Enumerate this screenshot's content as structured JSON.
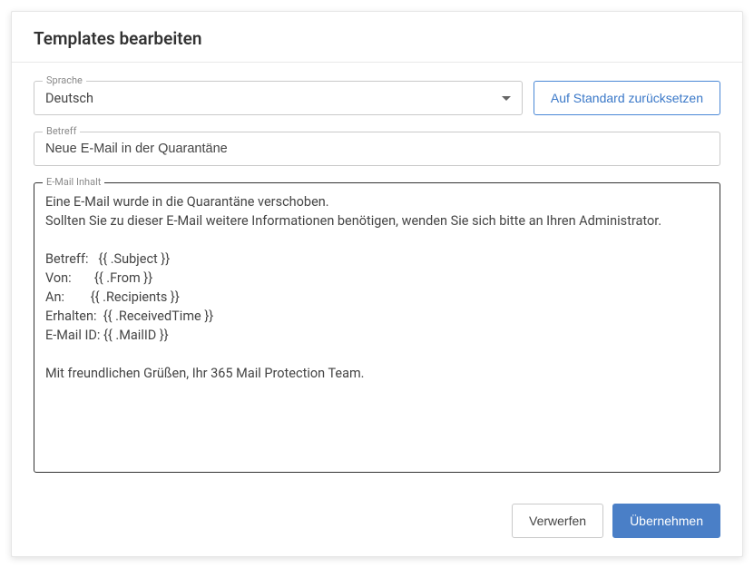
{
  "dialog": {
    "title": "Templates bearbeiten"
  },
  "language": {
    "label": "Sprache",
    "value": "Deutsch"
  },
  "reset": {
    "label": "Auf Standard zurücksetzen"
  },
  "subject": {
    "label": "Betreff",
    "value": "Neue E-Mail in der Quarantäne"
  },
  "content": {
    "label": "E-Mail Inhalt",
    "value": "Eine E-Mail wurde in die Quarantäne verschoben.\nSollten Sie zu dieser E-Mail weitere Informationen benötigen, wenden Sie sich bitte an Ihren Administrator.\n\nBetreff:   {{ .Subject }}\nVon:       {{ .From }}\nAn:        {{ .Recipients }}\nErhalten:  {{ .ReceivedTime }}\nE-Mail ID: {{ .MailID }}\n\nMit freundlichen Grüßen, Ihr 365 Mail Protection Team."
  },
  "footer": {
    "discard": "Verwerfen",
    "apply": "Übernehmen"
  }
}
